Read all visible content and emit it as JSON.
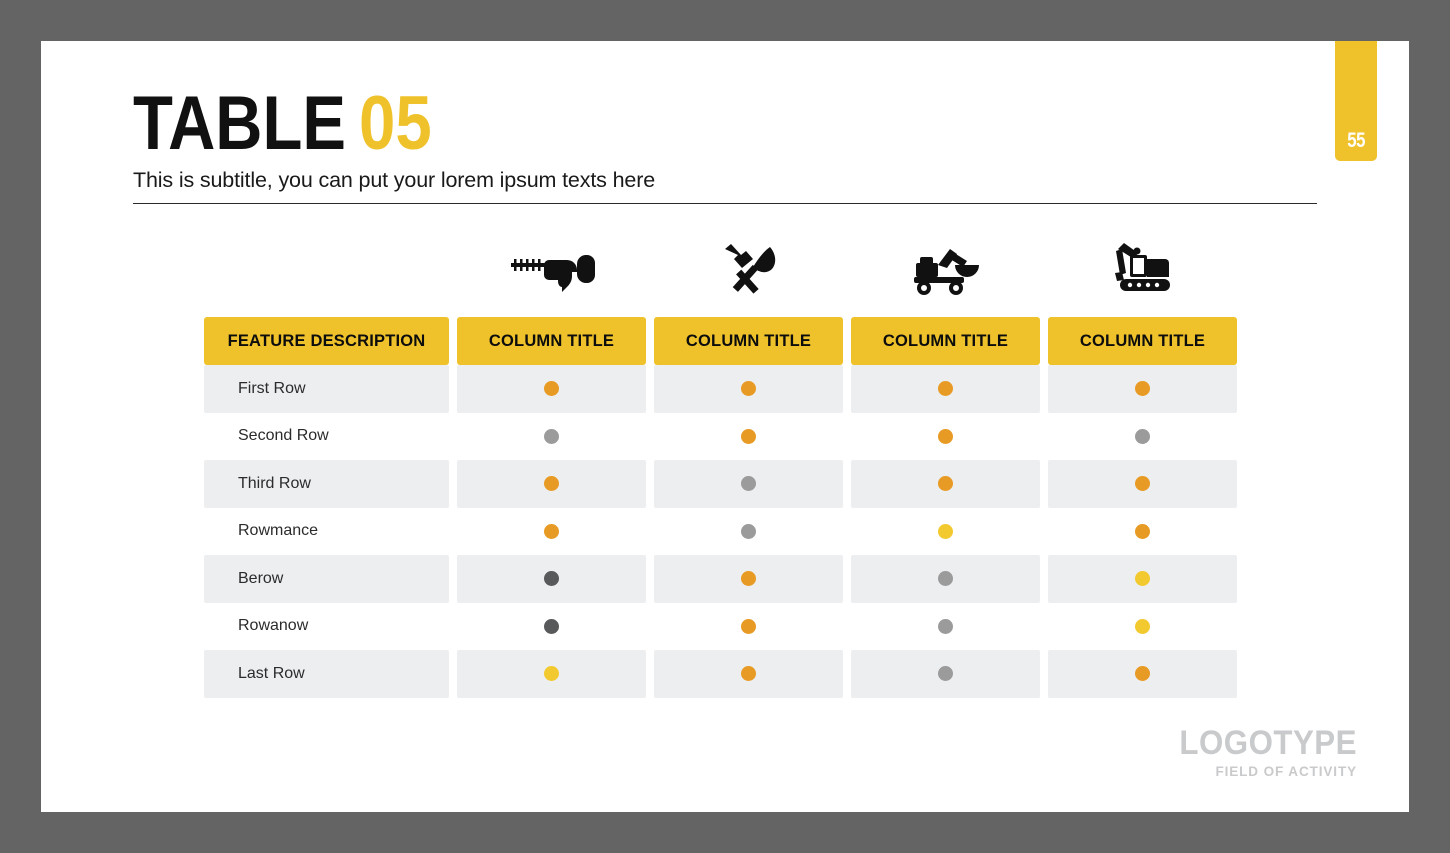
{
  "theme": {
    "frame_color": "#646464",
    "slide_bg": "#ffffff",
    "accent_yellow": "#EFC22B",
    "row_shade": "#EDEEF0",
    "dot_orange": "#E89B24",
    "dot_yellow": "#F2CA30",
    "dot_gray": "#9B9B9B",
    "dot_dark": "#58595B",
    "logo_gray": "#C9CACC"
  },
  "header": {
    "title_main": "TABLE",
    "title_number": "05",
    "subtitle": "This is subtitle, you can put your lorem ipsum texts here"
  },
  "page_tab": {
    "number": "55"
  },
  "table": {
    "icons": [
      {
        "name": "drill-icon",
        "label": "power drill"
      },
      {
        "name": "hammer-trowel-icon",
        "label": "hammer and trowel"
      },
      {
        "name": "wheeled-excavator-icon",
        "label": "wheeled excavator"
      },
      {
        "name": "tracked-excavator-icon",
        "label": "tracked excavator"
      }
    ],
    "headers": [
      "FEATURE DESCRIPTION",
      "COLUMN TITLE",
      "COLUMN TITLE",
      "COLUMN TITLE",
      "COLUMN TITLE"
    ],
    "rows": [
      {
        "label": "First Row",
        "shaded": true,
        "dots": [
          "orange",
          "orange",
          "orange",
          "orange"
        ]
      },
      {
        "label": "Second Row",
        "shaded": false,
        "dots": [
          "gray",
          "orange",
          "orange",
          "gray"
        ]
      },
      {
        "label": "Third Row",
        "shaded": true,
        "dots": [
          "orange",
          "gray",
          "orange",
          "orange"
        ]
      },
      {
        "label": "Rowmance",
        "shaded": false,
        "dots": [
          "orange",
          "gray",
          "yellow",
          "orange"
        ]
      },
      {
        "label": "Berow",
        "shaded": true,
        "dots": [
          "dark",
          "orange",
          "gray",
          "yellow"
        ]
      },
      {
        "label": "Rowanow",
        "shaded": false,
        "dots": [
          "dark",
          "orange",
          "gray",
          "yellow"
        ]
      },
      {
        "label": "Last Row",
        "shaded": true,
        "dots": [
          "yellow",
          "orange",
          "gray",
          "orange"
        ]
      }
    ]
  },
  "logo": {
    "name": "LOGOTYPE",
    "tagline": "FIELD OF ACTIVITY"
  }
}
